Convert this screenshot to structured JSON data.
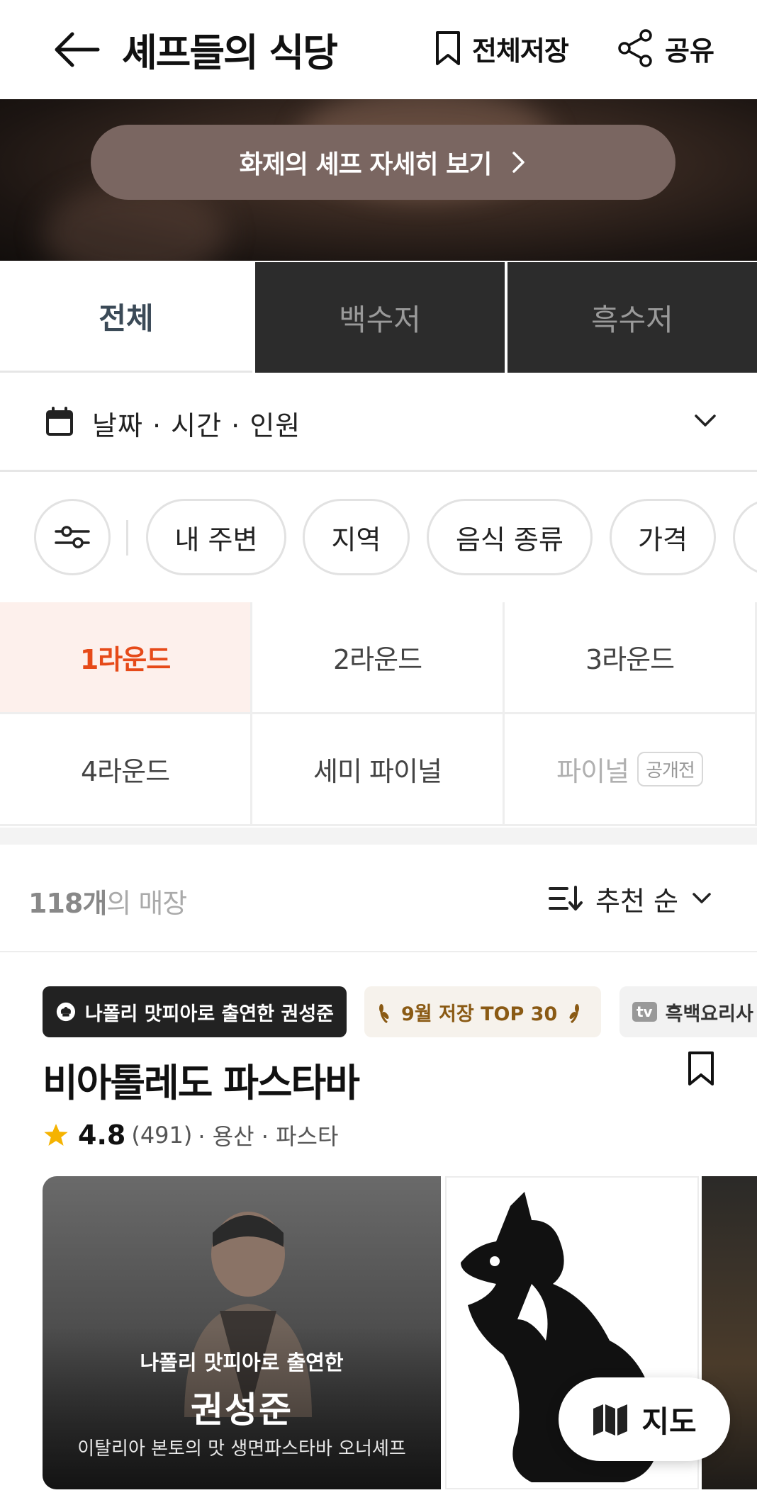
{
  "header": {
    "title": "셰프들의 식당",
    "save_all_label": "전체저장",
    "share_label": "공유"
  },
  "banner": {
    "button_label": "화제의 셰프 자세히 보기"
  },
  "tabs": [
    {
      "label": "전체",
      "active": true
    },
    {
      "label": "백수저",
      "active": false
    },
    {
      "label": "흑수저",
      "active": false
    }
  ],
  "date_filter": {
    "label": "날짜 · 시간 · 인원"
  },
  "filters": [
    "내 주변",
    "지역",
    "음식 종류",
    "가격"
  ],
  "rounds": [
    {
      "label": "1라운드",
      "active": true
    },
    {
      "label": "2라운드",
      "active": false
    },
    {
      "label": "3라운드",
      "active": false
    },
    {
      "label": "4라운드",
      "active": false
    },
    {
      "label": "세미 파이널",
      "active": false
    },
    {
      "label": "파이널",
      "active": false,
      "badge": "공개전"
    }
  ],
  "results": {
    "count_number": "118개",
    "count_suffix": "의 매장",
    "sort_label": "추천 순"
  },
  "store": {
    "badges": [
      {
        "label": "나폴리 맛피아로 출연한 권성준"
      },
      {
        "label": "9월 저장 TOP 30"
      },
      {
        "tv": "tv",
        "label": "흑백요리사"
      }
    ],
    "name": "비아톨레도 파스타바",
    "rating": "4.8",
    "reviews": "(491)",
    "meta": "· 용산 · 파스타",
    "photo": {
      "subtitle": "나폴리 맛피아로 출연한",
      "chef_name": "권성준",
      "description": "이탈리아 본토의 맛 생면파스타바 오너셰프"
    }
  },
  "map_button": {
    "label": "지도"
  },
  "colors": {
    "accent": "#e64a19",
    "dark_tab": "#2c2c2c",
    "banner_button": "#7a6661",
    "star": "#f5b301"
  }
}
